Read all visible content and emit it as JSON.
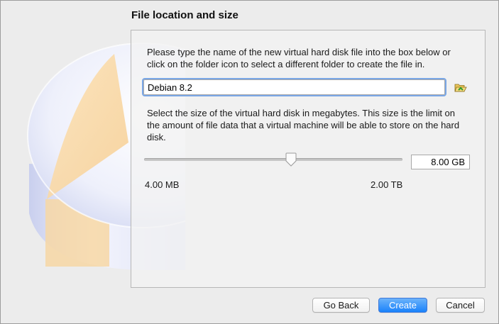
{
  "header": {
    "title": "File location and size"
  },
  "location": {
    "description": "Please type the name of the new virtual hard disk file into the box below or click on the folder icon to select a different folder to create the file in.",
    "filename": "Debian 8.2",
    "folder_icon": "folder-open-icon"
  },
  "size": {
    "description": "Select the size of the virtual hard disk in megabytes. This size is the limit on the amount of file data that a virtual machine will be able to store on the hard disk.",
    "value": "8.00 GB",
    "min_label": "4.00 MB",
    "max_label": "2.00 TB",
    "slider_fraction": 0.57
  },
  "buttons": {
    "back": "Go Back",
    "create": "Create",
    "cancel": "Cancel"
  },
  "colors": {
    "accent": "#1a82fb",
    "focus_ring": "#7aa7e6"
  }
}
